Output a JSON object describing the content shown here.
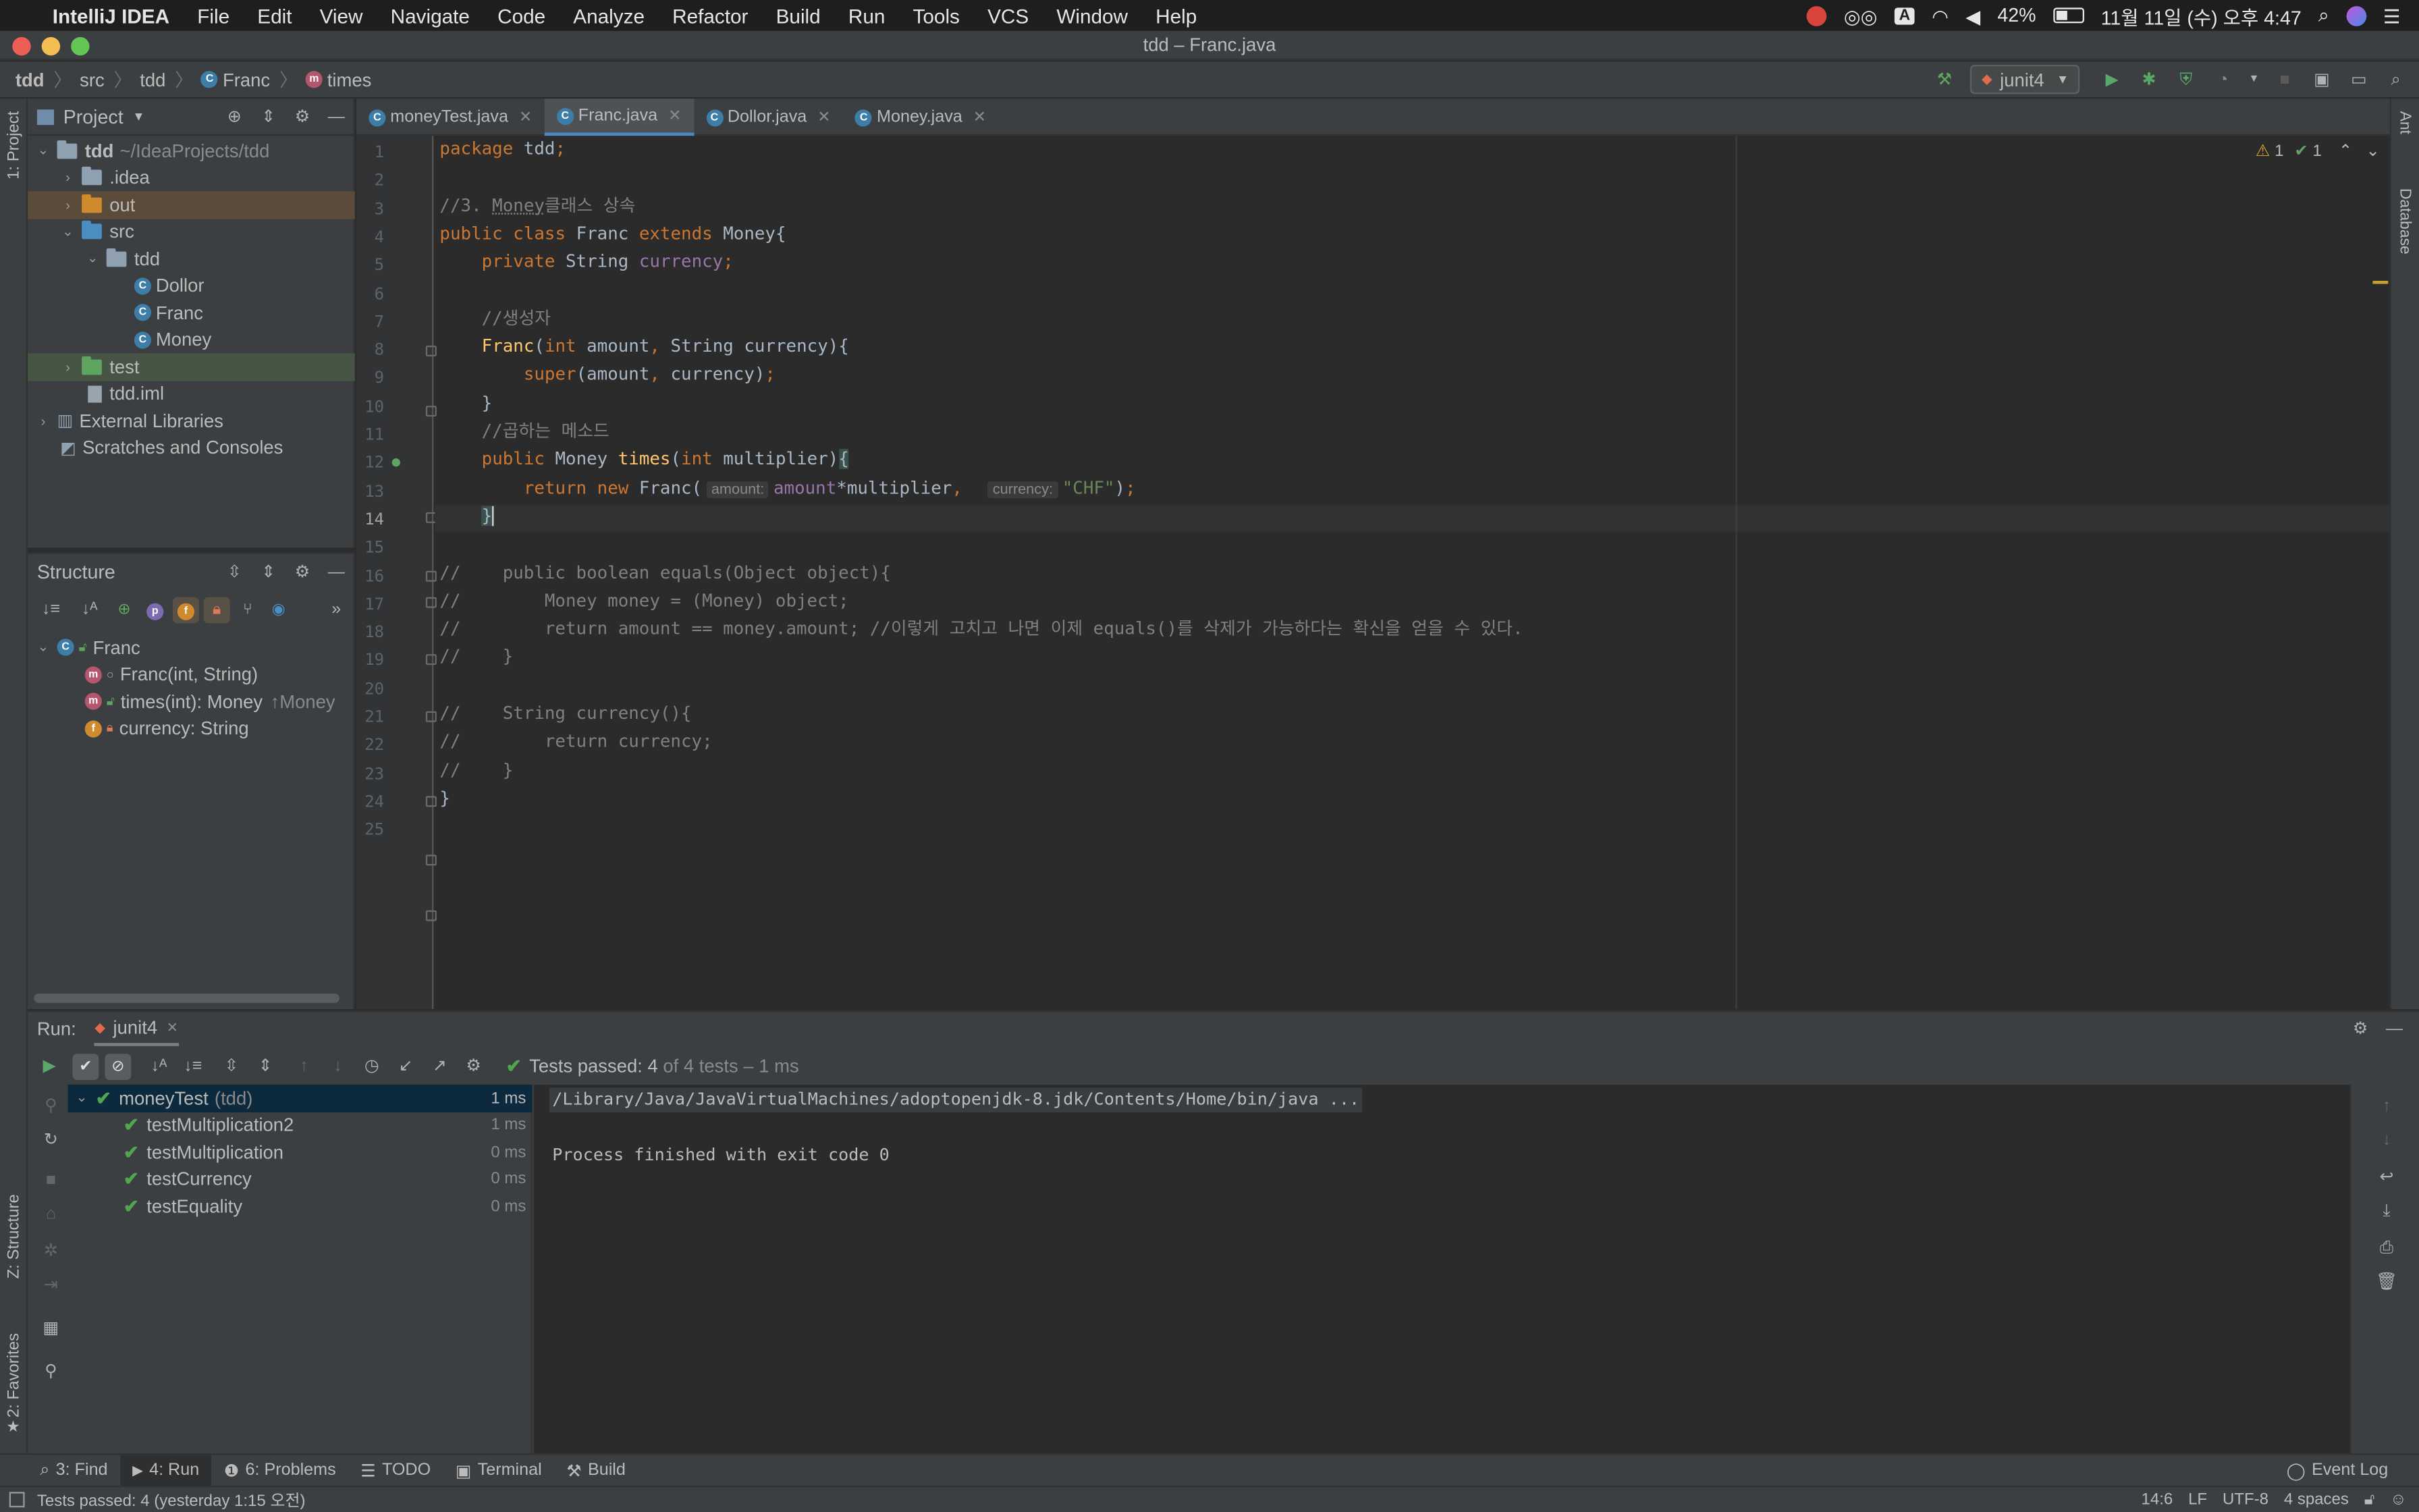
{
  "menubar": {
    "app": "IntelliJ IDEA",
    "items": [
      "File",
      "Edit",
      "View",
      "Navigate",
      "Code",
      "Analyze",
      "Refactor",
      "Build",
      "Run",
      "Tools",
      "VCS",
      "Window",
      "Help"
    ],
    "battery": "42%",
    "datetime": "11월 11일 (수) 오후 4:47",
    "input_method": "A"
  },
  "window": {
    "title": "tdd – Franc.java"
  },
  "navbar": {
    "breadcrumbs": [
      "tdd",
      "src",
      "tdd",
      "Franc",
      "times"
    ],
    "run_config": "junit4"
  },
  "left_strip": {
    "project": "1: Project",
    "structure": "Z: Structure",
    "favorites": "2: Favorites"
  },
  "right_strip": {
    "ant": "Ant",
    "database": "Database"
  },
  "project_panel": {
    "title": "Project",
    "tree": [
      {
        "label": "tdd",
        "extra": "~/IdeaProjects/tdd"
      },
      {
        "label": ".idea"
      },
      {
        "label": "out"
      },
      {
        "label": "src"
      },
      {
        "label": "tdd"
      },
      {
        "label": "Dollor"
      },
      {
        "label": "Franc"
      },
      {
        "label": "Money"
      },
      {
        "label": "test"
      },
      {
        "label": "tdd.iml"
      },
      {
        "label": "External Libraries"
      },
      {
        "label": "Scratches and Consoles"
      }
    ]
  },
  "structure_panel": {
    "title": "Structure",
    "tree": [
      {
        "label": "Franc"
      },
      {
        "label": "Franc(int, String)"
      },
      {
        "label": "times(int): Money",
        "extra": "↑Money"
      },
      {
        "label": "currency: String"
      }
    ]
  },
  "editor": {
    "tabs": [
      {
        "label": "moneyTest.java"
      },
      {
        "label": "Franc.java"
      },
      {
        "label": "Dollor.java"
      },
      {
        "label": "Money.java"
      }
    ],
    "inspections": {
      "warnings": "1",
      "ok": "1"
    },
    "lines": [
      {
        "n": "1",
        "text": "package tdd;"
      },
      {
        "n": "2",
        "text": ""
      },
      {
        "n": "3",
        "text": "//3. Money클래스 상속"
      },
      {
        "n": "4",
        "text": "public class Franc extends Money{"
      },
      {
        "n": "5",
        "text": "    private String currency;"
      },
      {
        "n": "6",
        "text": ""
      },
      {
        "n": "7",
        "text": "    //생성자"
      },
      {
        "n": "8",
        "text": "    Franc(int amount, String currency){"
      },
      {
        "n": "9",
        "text": "        super(amount, currency);"
      },
      {
        "n": "10",
        "text": "    }"
      },
      {
        "n": "11",
        "text": "    //곱하는 메소드"
      },
      {
        "n": "12",
        "text": "    public Money times(int multiplier){"
      },
      {
        "n": "13",
        "text": "        return new Franc( amount: amount*multiplier,  currency: \"CHF\");"
      },
      {
        "n": "14",
        "text": "    }"
      },
      {
        "n": "15",
        "text": ""
      },
      {
        "n": "16",
        "text": "//    public boolean equals(Object object){"
      },
      {
        "n": "17",
        "text": "//        Money money = (Money) object;"
      },
      {
        "n": "18",
        "text": "//        return amount == money.amount; //이렇게 고치고 나면 이제 equals()를 삭제가 가능하다는 확신을 얻을 수 있다."
      },
      {
        "n": "19",
        "text": "//    }"
      },
      {
        "n": "20",
        "text": ""
      },
      {
        "n": "21",
        "text": "//    String currency(){"
      },
      {
        "n": "22",
        "text": "//        return currency;"
      },
      {
        "n": "23",
        "text": "//    }"
      },
      {
        "n": "24",
        "text": "}"
      },
      {
        "n": "25",
        "text": ""
      }
    ],
    "hints": {
      "amount": "amount:",
      "currency": "currency:"
    }
  },
  "run_panel": {
    "label": "Run:",
    "tab": "junit4",
    "status_prefix": "Tests passed:",
    "status_count": "4",
    "status_suffix": "of 4 tests – 1 ms",
    "tests": [
      {
        "name": "moneyTest",
        "extra": "(tdd)",
        "time": "1 ms"
      },
      {
        "name": "testMultiplication2",
        "time": "1 ms"
      },
      {
        "name": "testMultiplication",
        "time": "0 ms"
      },
      {
        "name": "testCurrency",
        "time": "0 ms"
      },
      {
        "name": "testEquality",
        "time": "0 ms"
      }
    ],
    "console": [
      "/Library/Java/JavaVirtualMachines/adoptopenjdk-8.jdk/Contents/Home/bin/java ...",
      "",
      "Process finished with exit code 0"
    ]
  },
  "bottom_tools": [
    {
      "label": "3: Find"
    },
    {
      "label": "4: Run"
    },
    {
      "label": "6: Problems"
    },
    {
      "label": "TODO"
    },
    {
      "label": "Terminal"
    },
    {
      "label": "Build"
    }
  ],
  "event_log": "Event Log",
  "statusbar": {
    "message": "Tests passed: 4 (yesterday 1:15 오전)",
    "position": "14:6",
    "line_sep": "LF",
    "encoding": "UTF-8",
    "indent": "4 spaces"
  },
  "colors": {
    "keyword": "#cc7832",
    "comment": "#808080",
    "string": "#6a8759",
    "field": "#9876aa",
    "method": "#ffc66d",
    "pass": "#4fa64f",
    "accent": "#4a88c7"
  }
}
